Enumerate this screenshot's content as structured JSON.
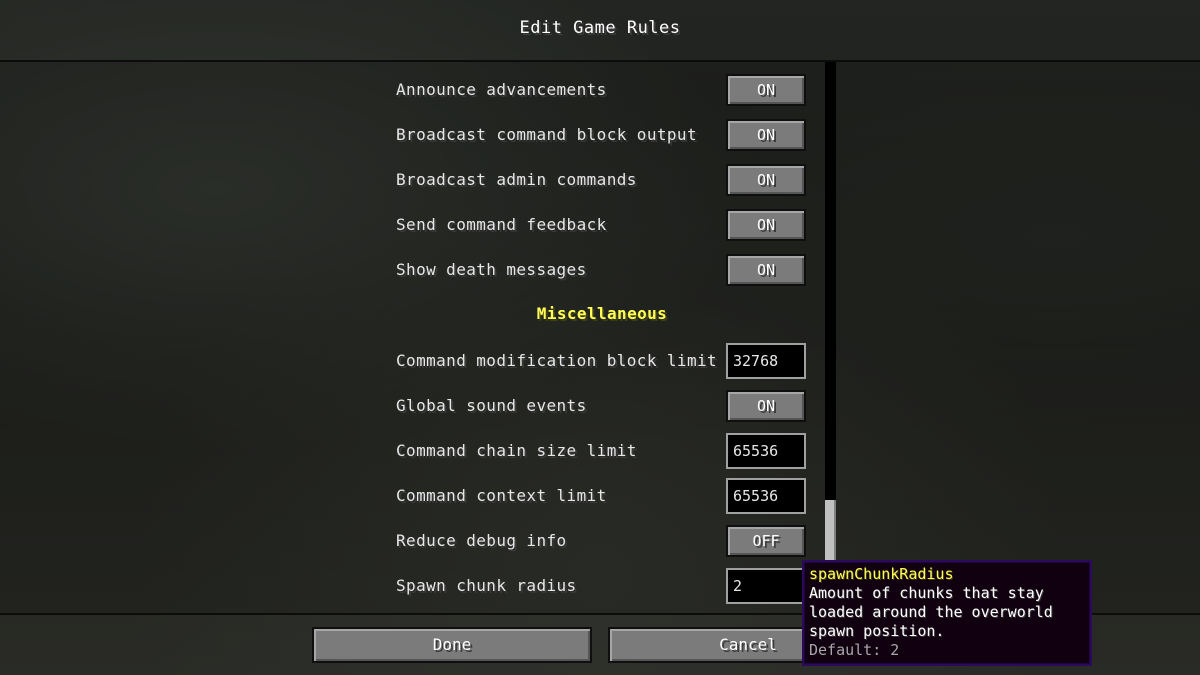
{
  "screen": {
    "title": "Edit Game Rules"
  },
  "rules_top": [
    {
      "label": "Announce advancements",
      "kind": "toggle",
      "value": "ON"
    },
    {
      "label": "Broadcast command block output",
      "kind": "toggle",
      "value": "ON"
    },
    {
      "label": "Broadcast admin commands",
      "kind": "toggle",
      "value": "ON"
    },
    {
      "label": "Send command feedback",
      "kind": "toggle",
      "value": "ON"
    },
    {
      "label": "Show death messages",
      "kind": "toggle",
      "value": "ON"
    }
  ],
  "category": {
    "label": "Miscellaneous",
    "color": "#ffff55"
  },
  "rules_misc": [
    {
      "label": "Command modification block limit",
      "kind": "number",
      "value": "32768"
    },
    {
      "label": "Global sound events",
      "kind": "toggle",
      "value": "ON"
    },
    {
      "label": "Command chain size limit",
      "kind": "number",
      "value": "65536"
    },
    {
      "label": "Command context limit",
      "kind": "number",
      "value": "65536"
    },
    {
      "label": "Reduce debug info",
      "kind": "toggle",
      "value": "OFF"
    },
    {
      "label": "Spawn chunk radius",
      "kind": "number",
      "value": "2"
    }
  ],
  "tooltip": {
    "title": "spawnChunkRadius",
    "lines": [
      "Amount of chunks that stay",
      "loaded around the overworld",
      "spawn position."
    ],
    "default_text": "Default: 2"
  },
  "buttons": {
    "done": "Done",
    "cancel": "Cancel"
  },
  "scrollbar": {
    "position_fraction": 0.85
  }
}
